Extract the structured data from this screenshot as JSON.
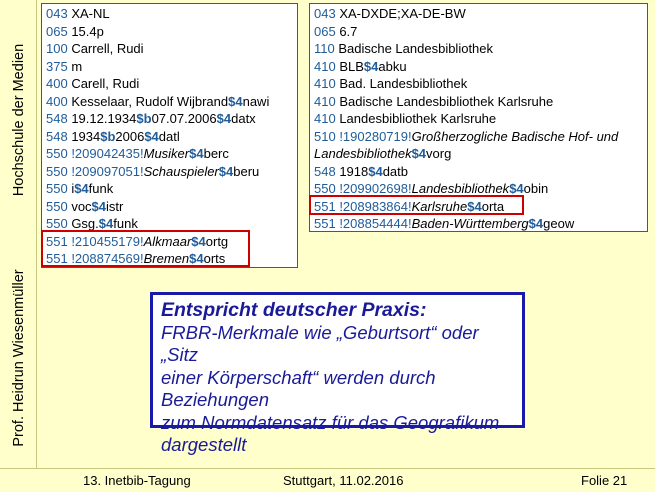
{
  "sidebar": {
    "top_text": "Hochschule der Medien",
    "bottom_text": "Prof. Heidrun Wiesenmüller"
  },
  "left_record": [
    [
      {
        "t": "tag",
        "v": "043 "
      },
      {
        "t": "val",
        "v": "XA-NL"
      }
    ],
    [
      {
        "t": "tag",
        "v": "065 "
      },
      {
        "t": "val",
        "v": "15.4p"
      }
    ],
    [
      {
        "t": "tag",
        "v": "100 "
      },
      {
        "t": "val",
        "v": "Carrell, Rudi"
      }
    ],
    [
      {
        "t": "tag",
        "v": "375 "
      },
      {
        "t": "val",
        "v": "m"
      }
    ],
    [
      {
        "t": "tag",
        "v": "400 "
      },
      {
        "t": "val",
        "v": "Carell, Rudi"
      }
    ],
    [
      {
        "t": "tag",
        "v": "400 "
      },
      {
        "t": "val",
        "v": "Kesselaar, Rudolf Wijbrand"
      },
      {
        "t": "sf",
        "v": "$4"
      },
      {
        "t": "val",
        "v": "nawi"
      }
    ],
    [
      {
        "t": "tag",
        "v": "548 "
      },
      {
        "t": "val",
        "v": "19.12.1934"
      },
      {
        "t": "sf",
        "v": "$b"
      },
      {
        "t": "val",
        "v": "07.07.2006"
      },
      {
        "t": "sf",
        "v": "$4"
      },
      {
        "t": "val",
        "v": "datx"
      }
    ],
    [
      {
        "t": "tag",
        "v": "548 "
      },
      {
        "t": "val",
        "v": "1934"
      },
      {
        "t": "sf",
        "v": "$b"
      },
      {
        "t": "val",
        "v": "2006"
      },
      {
        "t": "sf",
        "v": "$4"
      },
      {
        "t": "val",
        "v": "datl"
      }
    ],
    [
      {
        "t": "tag",
        "v": "550 "
      },
      {
        "t": "link",
        "v": "!209042435!"
      },
      {
        "t": "em",
        "v": "Musiker"
      },
      {
        "t": "sf",
        "v": "$4"
      },
      {
        "t": "val",
        "v": "berc"
      }
    ],
    [
      {
        "t": "tag",
        "v": "550 "
      },
      {
        "t": "link",
        "v": "!209097051!"
      },
      {
        "t": "em",
        "v": "Schauspieler"
      },
      {
        "t": "sf",
        "v": "$4"
      },
      {
        "t": "val",
        "v": "beru"
      }
    ],
    [
      {
        "t": "tag",
        "v": "550 "
      },
      {
        "t": "val",
        "v": "i"
      },
      {
        "t": "sf",
        "v": "$4"
      },
      {
        "t": "val",
        "v": "funk"
      }
    ],
    [
      {
        "t": "tag",
        "v": "550 "
      },
      {
        "t": "val",
        "v": "voc"
      },
      {
        "t": "sf",
        "v": "$4"
      },
      {
        "t": "val",
        "v": "istr"
      }
    ],
    [
      {
        "t": "tag",
        "v": "550 "
      },
      {
        "t": "val",
        "v": "Gsg."
      },
      {
        "t": "sf",
        "v": "$4"
      },
      {
        "t": "val",
        "v": "funk"
      }
    ],
    [
      {
        "t": "tag",
        "v": "551 "
      },
      {
        "t": "link",
        "v": "!210455179!"
      },
      {
        "t": "em",
        "v": "Alkmaar"
      },
      {
        "t": "sf",
        "v": "$4"
      },
      {
        "t": "val",
        "v": "ortg"
      }
    ],
    [
      {
        "t": "tag",
        "v": "551 "
      },
      {
        "t": "link",
        "v": "!208874569!"
      },
      {
        "t": "em",
        "v": "Bremen"
      },
      {
        "t": "sf",
        "v": "$4"
      },
      {
        "t": "val",
        "v": "orts"
      }
    ]
  ],
  "right_record": [
    [
      {
        "t": "tag",
        "v": "043 "
      },
      {
        "t": "val",
        "v": "XA-DXDE;XA-DE-BW"
      }
    ],
    [
      {
        "t": "tag",
        "v": "065 "
      },
      {
        "t": "val",
        "v": "6.7"
      }
    ],
    [
      {
        "t": "tag",
        "v": "110 "
      },
      {
        "t": "val",
        "v": "Badische Landesbibliothek"
      }
    ],
    [
      {
        "t": "tag",
        "v": "410 "
      },
      {
        "t": "val",
        "v": "BLB"
      },
      {
        "t": "sf",
        "v": "$4"
      },
      {
        "t": "val",
        "v": "abku"
      }
    ],
    [
      {
        "t": "tag",
        "v": "410 "
      },
      {
        "t": "val",
        "v": "Bad. Landesbibliothek"
      }
    ],
    [
      {
        "t": "tag",
        "v": "410 "
      },
      {
        "t": "val",
        "v": "Badische Landesbibliothek Karlsruhe"
      }
    ],
    [
      {
        "t": "tag",
        "v": "410 "
      },
      {
        "t": "val",
        "v": "Landesbibliothek Karlsruhe"
      }
    ],
    [
      {
        "t": "tag",
        "v": "510 "
      },
      {
        "t": "link",
        "v": "!190280719!"
      },
      {
        "t": "em",
        "v": "Großherzogliche Badische Hof- und"
      }
    ],
    [
      {
        "t": "em",
        "v": "Landesbibliothek"
      },
      {
        "t": "sf",
        "v": "$4"
      },
      {
        "t": "val",
        "v": "vorg"
      }
    ],
    [
      {
        "t": "tag",
        "v": "548 "
      },
      {
        "t": "val",
        "v": "1918"
      },
      {
        "t": "sf",
        "v": "$4"
      },
      {
        "t": "val",
        "v": "datb"
      }
    ],
    [
      {
        "t": "tag",
        "v": "550 "
      },
      {
        "t": "link",
        "v": "!209902698!"
      },
      {
        "t": "em",
        "v": "Landesbibliothek"
      },
      {
        "t": "sf",
        "v": "$4"
      },
      {
        "t": "val",
        "v": "obin"
      }
    ],
    [
      {
        "t": "tag",
        "v": "551 "
      },
      {
        "t": "link",
        "v": "!208983864!"
      },
      {
        "t": "em",
        "v": "Karlsruhe"
      },
      {
        "t": "sf",
        "v": "$4"
      },
      {
        "t": "val",
        "v": "orta"
      }
    ],
    [
      {
        "t": "tag",
        "v": "551 "
      },
      {
        "t": "link",
        "v": "!208854444!"
      },
      {
        "t": "em",
        "v": "Baden-Württemberg"
      },
      {
        "t": "sf",
        "v": "$4"
      },
      {
        "t": "val",
        "v": "geow"
      }
    ]
  ],
  "callout": {
    "title": "Entspricht deutscher Praxis:",
    "line1": "FRBR-Merkmale wie „Geburtsort“ oder „Sitz",
    "line2": "einer Körperschaft“ werden durch Beziehungen",
    "line3": "zum Normdatensatz für das Geografikum",
    "line4": "dargestellt"
  },
  "footer": {
    "event": "13. Inetbib-Tagung",
    "place_date": "Stuttgart, 11.02.2016",
    "slide": "Folie 21"
  },
  "colors": {
    "background": "#ffffcc",
    "tag_blue": "#1f5c99",
    "highlight_red": "#cc0000",
    "callout_blue": "#1a1a99"
  }
}
